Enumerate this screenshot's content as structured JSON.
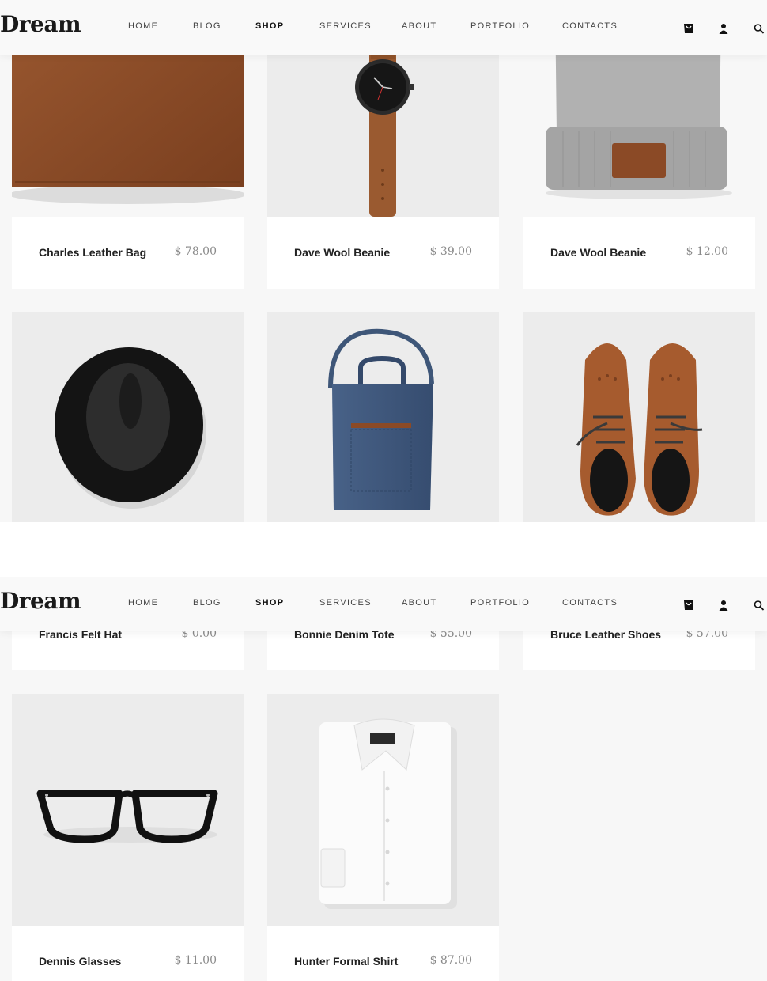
{
  "brand": {
    "logo": "Dream"
  },
  "nav": {
    "items": [
      "HOME",
      "BLOG",
      "SHOP",
      "SERVICES",
      "ABOUT",
      "PORTFOLIO",
      "CONTACTS"
    ],
    "active": "SHOP",
    "icons": [
      "cart-icon",
      "user-icon",
      "search-icon"
    ]
  },
  "products": [
    {
      "name": "Charles Leather Bag",
      "price": "$ 78.00",
      "image": "leather-wallet"
    },
    {
      "name": "Dave Wool Beanie",
      "price": "$ 39.00",
      "image": "wrist-watch"
    },
    {
      "name": "Dave Wool Beanie",
      "price": "$ 12.00",
      "image": "wool-beanie"
    },
    {
      "name": "Francis Felt Hat",
      "price": "$ 0.00",
      "image": "felt-hat"
    },
    {
      "name": "Bonnie Denim Tote",
      "price": "$ 55.00",
      "image": "denim-tote"
    },
    {
      "name": "Bruce Leather Shoes",
      "price": "$ 57.00",
      "image": "leather-shoes"
    },
    {
      "name": "Dennis Glasses",
      "price": "$ 11.00",
      "image": "eyeglasses"
    },
    {
      "name": "Hunter Formal Shirt",
      "price": "$ 87.00",
      "image": "formal-shirt"
    }
  ]
}
